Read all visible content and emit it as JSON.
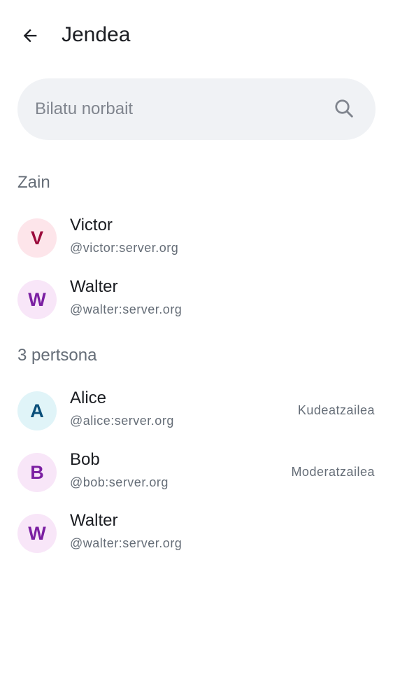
{
  "header": {
    "title": "Jendea",
    "back_icon": "arrow-left-icon"
  },
  "search": {
    "placeholder": "Bilatu norbait",
    "value": "",
    "icon": "search-icon"
  },
  "sections": [
    {
      "title": "Zain",
      "members": [
        {
          "initial": "V",
          "name": "Victor",
          "id": "@victor:server.org",
          "role": "",
          "avatar_bg": "#fde5ea",
          "avatar_fg": "#9b0b3c"
        },
        {
          "initial": "W",
          "name": "Walter",
          "id": "@walter:server.org",
          "role": "",
          "avatar_bg": "#f8e6f8",
          "avatar_fg": "#7b1fa2"
        }
      ]
    },
    {
      "title": "3 pertsona",
      "members": [
        {
          "initial": "A",
          "name": "Alice",
          "id": "@alice:server.org",
          "role": "Kudeatzailea",
          "avatar_bg": "#e0f4f8",
          "avatar_fg": "#0a4f7a"
        },
        {
          "initial": "B",
          "name": "Bob",
          "id": "@bob:server.org",
          "role": "Moderatzailea",
          "avatar_bg": "#f8e6f8",
          "avatar_fg": "#7b1fa2"
        },
        {
          "initial": "W",
          "name": "Walter",
          "id": "@walter:server.org",
          "role": "",
          "avatar_bg": "#f8e6f8",
          "avatar_fg": "#7b1fa2"
        }
      ]
    }
  ]
}
